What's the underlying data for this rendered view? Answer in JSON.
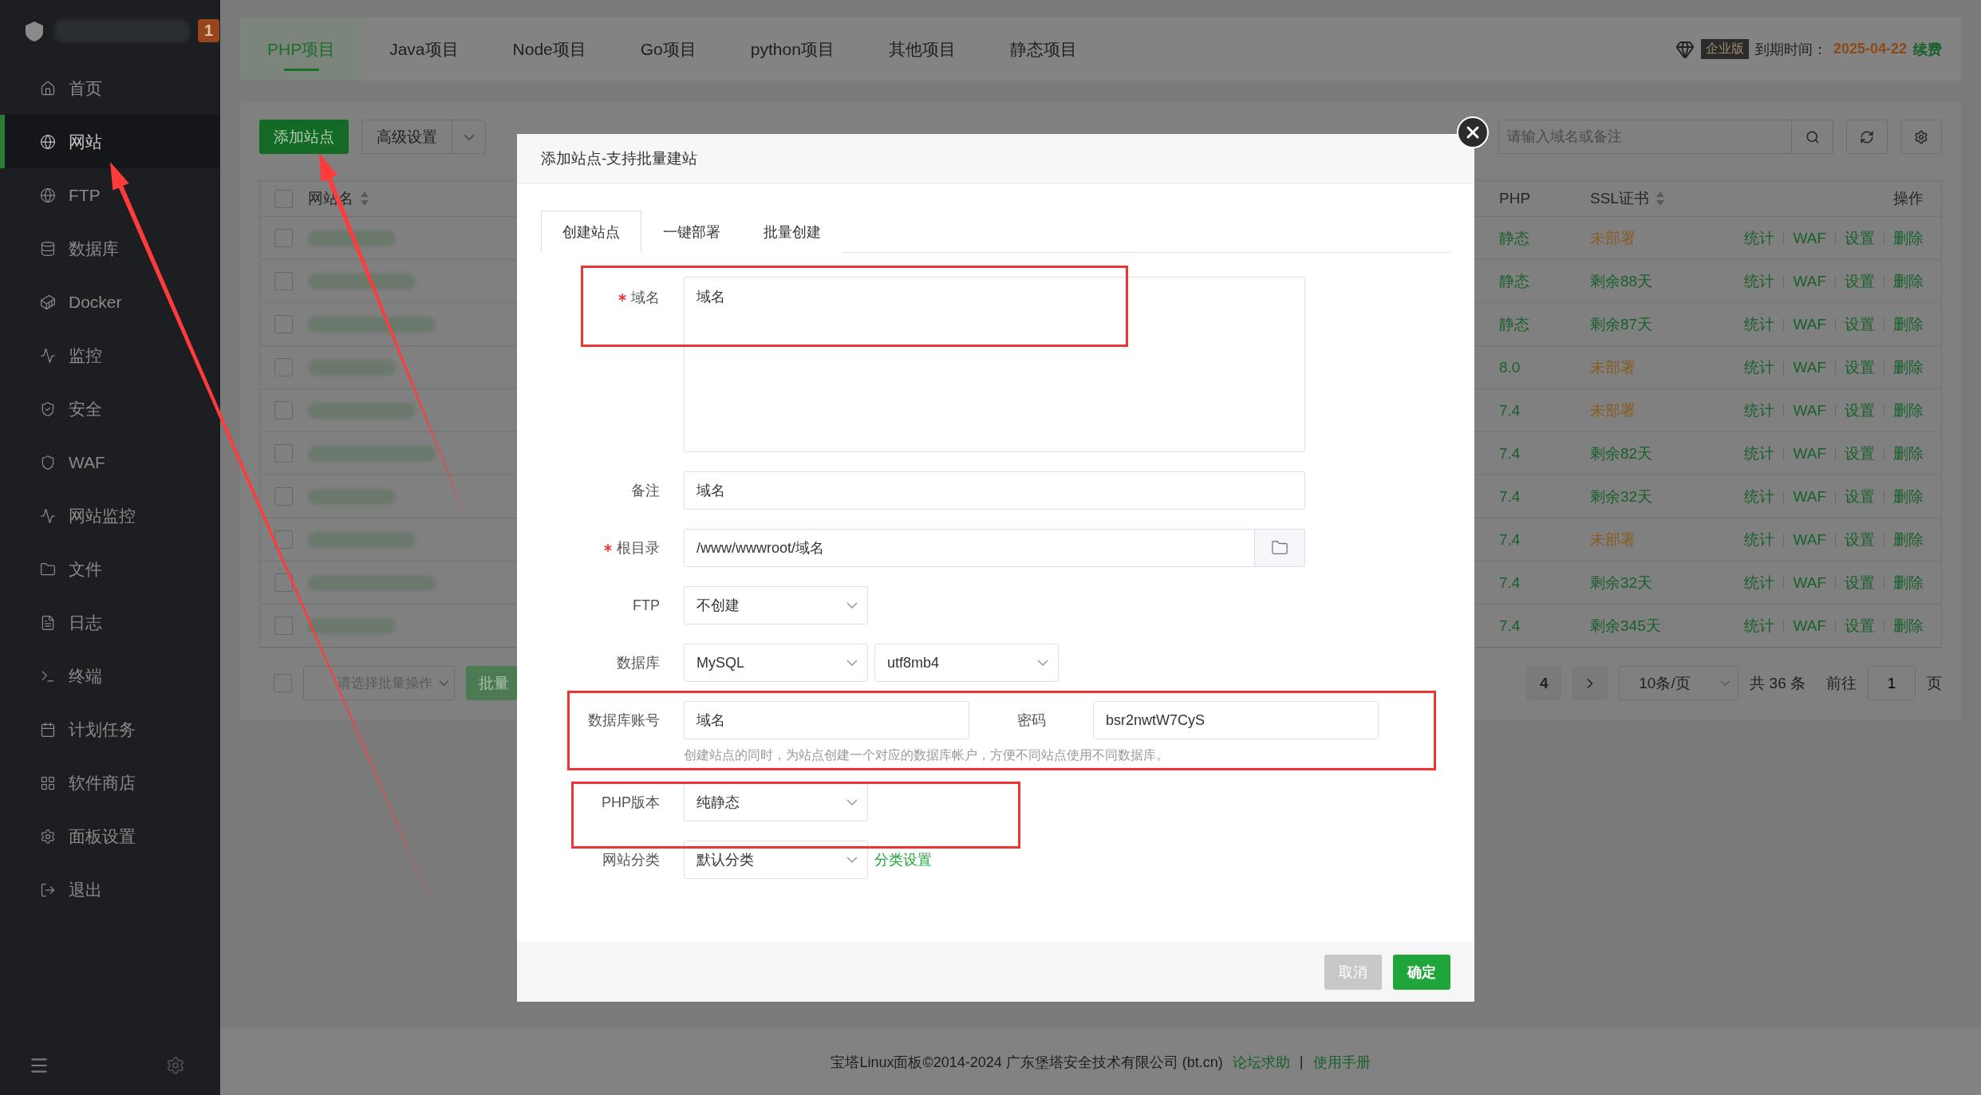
{
  "sidebar": {
    "badge": "1",
    "items": [
      {
        "label": "首页",
        "selected": false
      },
      {
        "label": "网站",
        "selected": true
      },
      {
        "label": "FTP",
        "selected": false
      },
      {
        "label": "数据库",
        "selected": false
      },
      {
        "label": "Docker",
        "selected": false
      },
      {
        "label": "监控",
        "selected": false
      },
      {
        "label": "安全",
        "selected": false
      },
      {
        "label": "WAF",
        "selected": false
      },
      {
        "label": "网站监控",
        "selected": false
      },
      {
        "label": "文件",
        "selected": false
      },
      {
        "label": "日志",
        "selected": false
      },
      {
        "label": "终端",
        "selected": false
      },
      {
        "label": "计划任务",
        "selected": false
      },
      {
        "label": "软件商店",
        "selected": false
      },
      {
        "label": "面板设置",
        "selected": false
      },
      {
        "label": "退出",
        "selected": false
      }
    ]
  },
  "top_tabs": [
    {
      "label": "PHP项目",
      "selected": true
    },
    {
      "label": "Java项目",
      "selected": false
    },
    {
      "label": "Node项目",
      "selected": false
    },
    {
      "label": "Go项目",
      "selected": false
    },
    {
      "label": "python项目",
      "selected": false
    },
    {
      "label": "其他项目",
      "selected": false
    },
    {
      "label": "静态项目",
      "selected": false
    }
  ],
  "license": {
    "edition": "企业版",
    "expiry_label": "到期时间：",
    "expiry_date": "2025-04-22",
    "renew": "续费"
  },
  "toolbar": {
    "add_button": "添加站点",
    "advanced_button": "高级设置",
    "search": {
      "placeholder": "请输入域名或备注"
    }
  },
  "table": {
    "header_checked": false,
    "columns": [
      {
        "label": "网站名",
        "sortable": true
      },
      {
        "label": "PHP",
        "sortable": false
      },
      {
        "label": "SSL证书",
        "sortable": true
      },
      {
        "label": "操作",
        "sortable": false
      }
    ],
    "rows": [
      {
        "checked": false,
        "php": "静态",
        "ssl": "未部署",
        "ssl_deployed": false,
        "actions": [
          "统计",
          "WAF",
          "设置",
          "删除"
        ]
      },
      {
        "checked": false,
        "php": "静态",
        "ssl": "剩余88天",
        "ssl_deployed": true,
        "actions": [
          "统计",
          "WAF",
          "设置",
          "删除"
        ]
      },
      {
        "checked": false,
        "php": "静态",
        "ssl": "剩余87天",
        "ssl_deployed": true,
        "actions": [
          "统计",
          "WAF",
          "设置",
          "删除"
        ]
      },
      {
        "checked": false,
        "php": "8.0",
        "ssl": "未部署",
        "ssl_deployed": false,
        "actions": [
          "统计",
          "WAF",
          "设置",
          "删除"
        ]
      },
      {
        "checked": false,
        "php": "7.4",
        "ssl": "未部署",
        "ssl_deployed": false,
        "actions": [
          "统计",
          "WAF",
          "设置",
          "删除"
        ]
      },
      {
        "checked": false,
        "php": "7.4",
        "ssl": "剩余82天",
        "ssl_deployed": true,
        "actions": [
          "统计",
          "WAF",
          "设置",
          "删除"
        ]
      },
      {
        "checked": false,
        "php": "7.4",
        "ssl": "剩余32天",
        "ssl_deployed": true,
        "actions": [
          "统计",
          "WAF",
          "设置",
          "删除"
        ]
      },
      {
        "checked": false,
        "php": "7.4",
        "ssl": "未部署",
        "ssl_deployed": false,
        "actions": [
          "统计",
          "WAF",
          "设置",
          "删除"
        ]
      },
      {
        "checked": false,
        "php": "7.4",
        "ssl": "剩余32天",
        "ssl_deployed": true,
        "actions": [
          "统计",
          "WAF",
          "设置",
          "删除"
        ]
      },
      {
        "checked": false,
        "php": "7.4",
        "ssl": "剩余345天",
        "ssl_deployed": true,
        "actions": [
          "统计",
          "WAF",
          "设置",
          "删除"
        ]
      }
    ]
  },
  "batch": {
    "checked": false,
    "select_placeholder": "请选择批量操作",
    "button": "批量"
  },
  "pagination": {
    "pages": [
      {
        "label": "4",
        "selected": false
      }
    ],
    "page_size": "10条/页",
    "total": "共 36 条",
    "goto_label": "前往",
    "goto_value": "1",
    "page_suffix": "页"
  },
  "modal": {
    "title": "添加站点-支持批量建站",
    "tabs": [
      {
        "label": "创建站点",
        "selected": true
      },
      {
        "label": "一键部署",
        "selected": false
      },
      {
        "label": "批量创建",
        "selected": false
      }
    ],
    "fields": [
      {
        "kind": "textarea",
        "label": "域名",
        "required": true,
        "value": "域名"
      },
      {
        "kind": "input",
        "label": "备注",
        "required": false,
        "value": "域名"
      },
      {
        "kind": "folder",
        "label": "根目录",
        "required": true,
        "value": "/www/wwwroot/域名"
      },
      {
        "kind": "select",
        "label": "FTP",
        "required": false,
        "value": "不创建"
      },
      {
        "kind": "select_pair",
        "label": "数据库",
        "required": false,
        "values": [
          "MySQL",
          "utf8mb4"
        ]
      },
      {
        "kind": "account",
        "label": "数据库账号",
        "required": false,
        "value": "域名",
        "password_label": "密码",
        "password": "bsr2nwtW7CyS",
        "hint": "创建站点的同时，为站点创建一个对应的数据库帐户，方便不同站点使用不同数据库。"
      },
      {
        "kind": "select",
        "label": "PHP版本",
        "required": false,
        "value": "纯静态"
      },
      {
        "kind": "select",
        "label": "网站分类",
        "required": false,
        "value": "默认分类",
        "link": "分类设置"
      }
    ],
    "cancel": "取消",
    "confirm": "确定"
  },
  "footer": {
    "text": "宝塔Linux面板©2014-2024 广东堡塔安全技术有限公司 (bt.cn)",
    "links": [
      "论坛求助",
      "使用手册"
    ],
    "separator": "|"
  }
}
